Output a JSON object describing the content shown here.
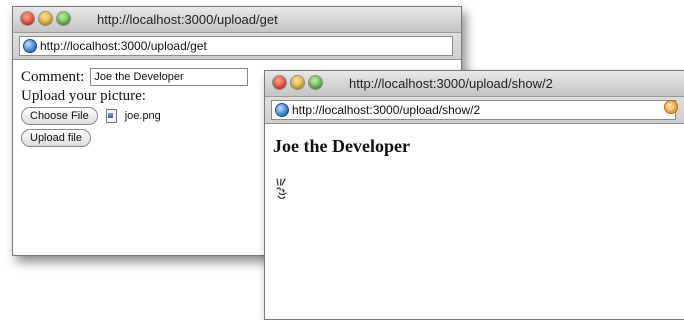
{
  "window_upload_form": {
    "title": "http://localhost:3000/upload/get",
    "address": "http://localhost:3000/upload/get",
    "form": {
      "comment_label": "Comment:",
      "comment_value": "Joe the Developer",
      "upload_label": "Upload your picture:",
      "choose_file_label": "Choose File",
      "selected_file_name": "joe.png",
      "upload_button_label": "Upload file"
    }
  },
  "window_show": {
    "title": "http://localhost:3000/upload/show/2",
    "address": "http://localhost:3000/upload/show/2",
    "heading": "Joe the Developer",
    "image_alt": "joe.png"
  },
  "colors": {
    "red_light": "#d42a1a",
    "yellow_light": "#d19a10",
    "green_light": "#3f9c1e"
  }
}
